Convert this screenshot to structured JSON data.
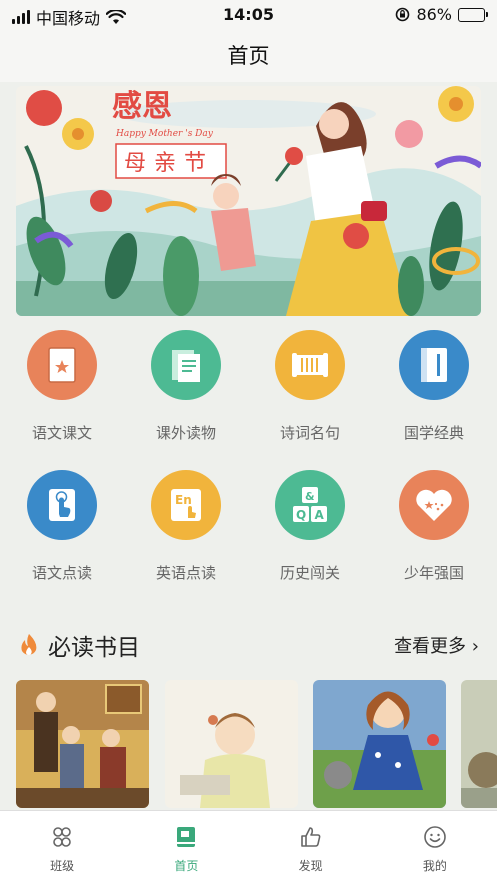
{
  "status_bar": {
    "carrier": "中国移动",
    "time": "14:05",
    "battery": "86%",
    "battery_level": 0.86
  },
  "nav": {
    "title": "首页"
  },
  "banner": {
    "title": "感恩",
    "subtitle": "Happy Mother 's Day",
    "caption": "母亲节"
  },
  "grid": {
    "items": [
      {
        "label": "语文课文",
        "icon": "textbook-icon",
        "color": "#e8835a"
      },
      {
        "label": "课外读物",
        "icon": "books-icon",
        "color": "#4dba93"
      },
      {
        "label": "诗词名句",
        "icon": "scroll-icon",
        "color": "#f1b43c"
      },
      {
        "label": "国学经典",
        "icon": "classic-book-icon",
        "color": "#3a8ac9"
      },
      {
        "label": "语文点读",
        "icon": "tap-read-icon",
        "color": "#3a8ac9"
      },
      {
        "label": "英语点读",
        "icon": "english-read-icon",
        "color": "#f1b43c"
      },
      {
        "label": "历史闯关",
        "icon": "quiz-blocks-icon",
        "color": "#4dba93"
      },
      {
        "label": "少年强国",
        "icon": "heart-star-icon",
        "color": "#e8835a"
      }
    ]
  },
  "section": {
    "title": "必读书目",
    "more": "查看更多"
  },
  "tabs": [
    {
      "label": "班级",
      "icon": "class-icon",
      "active": false
    },
    {
      "label": "首页",
      "icon": "home-book-icon",
      "active": true
    },
    {
      "label": "发现",
      "icon": "thumbs-up-icon",
      "active": false
    },
    {
      "label": "我的",
      "icon": "smile-icon",
      "active": false
    }
  ],
  "colors": {
    "accent": "#3aa87b",
    "background": "#eef0ec"
  }
}
